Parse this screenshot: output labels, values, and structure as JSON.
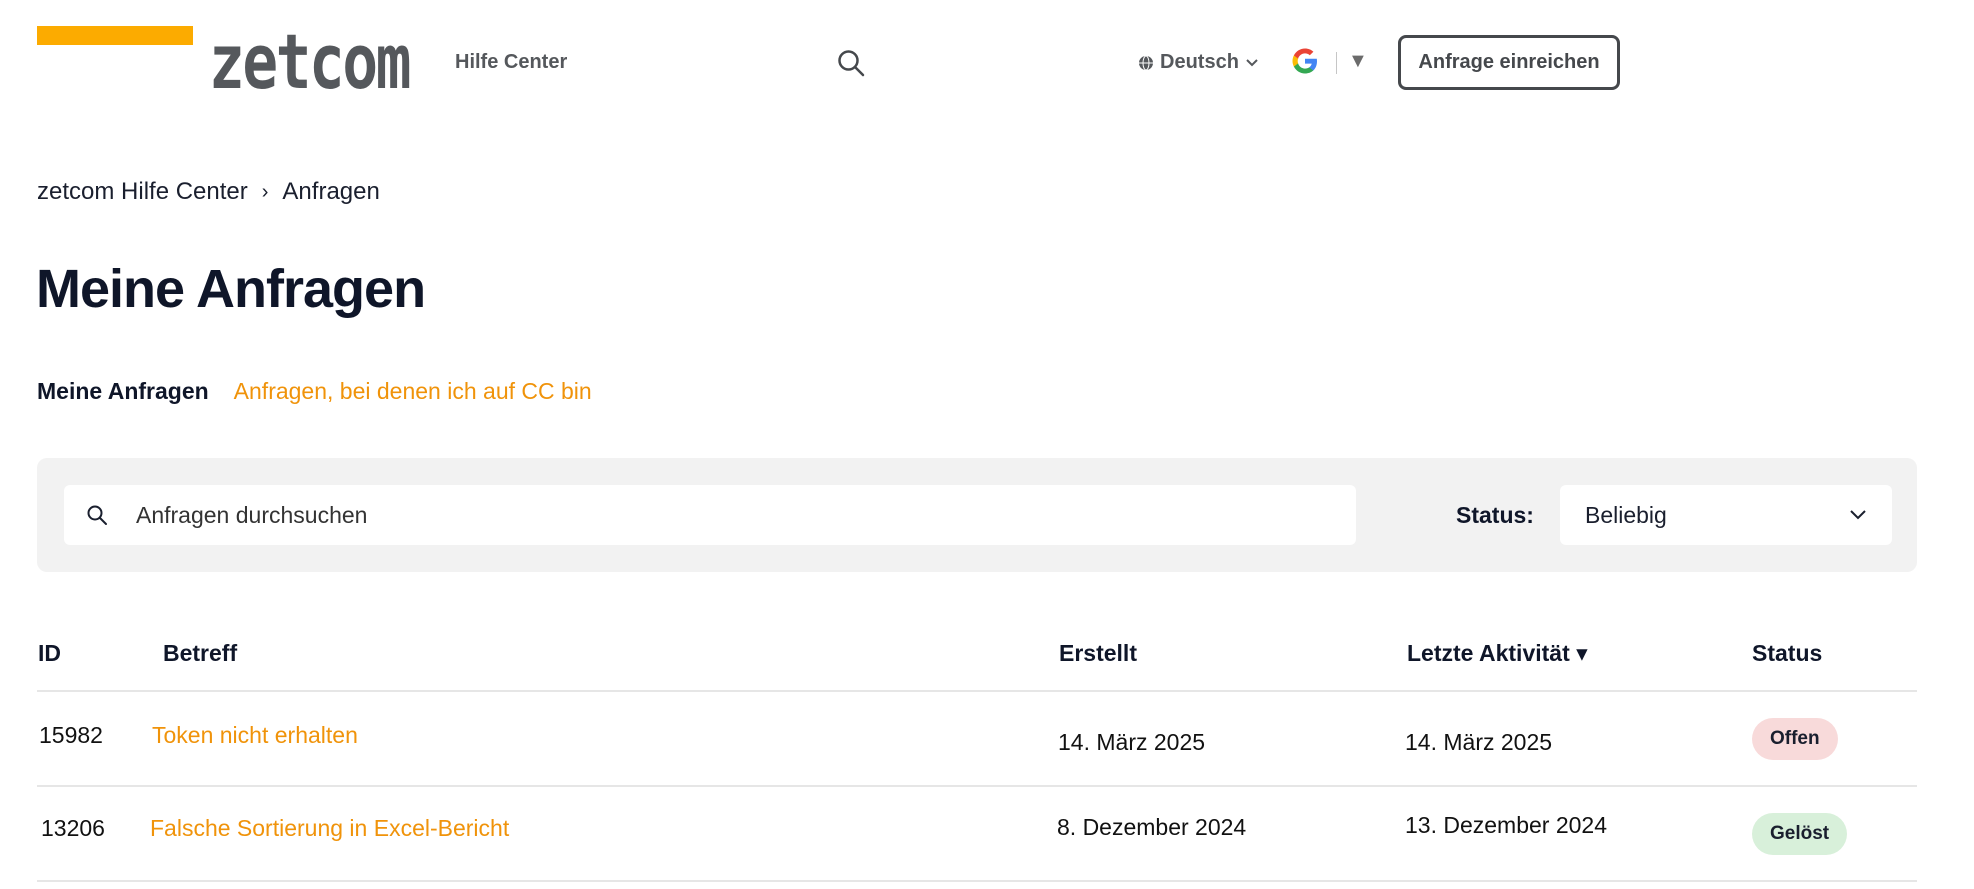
{
  "header": {
    "logo_text": "zetcom",
    "help_center": "Hilfe Center",
    "language": "Deutsch",
    "submit_label": "Anfrage einreichen",
    "google_caret": "▼",
    "brand_color": "#fcab00"
  },
  "breadcrumb": {
    "items": [
      "zetcom Hilfe Center",
      "Anfragen"
    ],
    "separator": "›"
  },
  "page": {
    "title": "Meine Anfragen"
  },
  "tabs": {
    "active": "Meine Anfragen",
    "cc": "Anfragen, bei denen ich auf CC bin"
  },
  "filter": {
    "search_placeholder": "Anfragen durchsuchen",
    "status_label": "Status:",
    "status_value": "Beliebig"
  },
  "table": {
    "columns": {
      "id": "ID",
      "subject": "Betreff",
      "created": "Erstellt",
      "last_activity": "Letzte Aktivität ▾",
      "status": "Status"
    },
    "rows": [
      {
        "id": "15982",
        "subject": "Token nicht erhalten",
        "created": "14. März 2025",
        "last_activity": "14. März 2025",
        "status": "Offen"
      },
      {
        "id": "13206",
        "subject": "Falsche Sortierung in Excel-Bericht",
        "created": "8. Dezember 2024",
        "last_activity": "13. Dezember 2024",
        "status": "Gelöst"
      }
    ]
  }
}
